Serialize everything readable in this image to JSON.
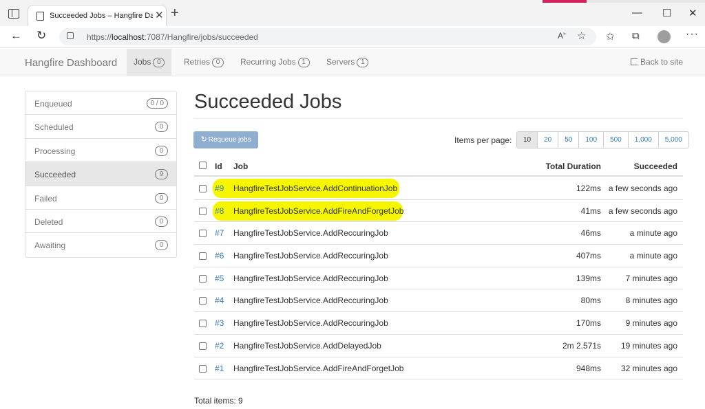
{
  "browser": {
    "tab_title": "Succeeded Jobs – Hangfire Dash",
    "url_prefix": "https://",
    "url_host": "localhost",
    "url_rest": ":7087/Hangfire/jobs/succeeded"
  },
  "navbar": {
    "brand": "Hangfire Dashboard",
    "items": [
      {
        "label": "Jobs",
        "count": "0"
      },
      {
        "label": "Retries",
        "count": "0"
      },
      {
        "label": "Recurring Jobs",
        "count": "1"
      },
      {
        "label": "Servers",
        "count": "1"
      }
    ],
    "back_label": "Back to site"
  },
  "sidebar": {
    "items": [
      {
        "label": "Enqueued",
        "count": "0 / 0"
      },
      {
        "label": "Scheduled",
        "count": "0"
      },
      {
        "label": "Processing",
        "count": "0"
      },
      {
        "label": "Succeeded",
        "count": "9"
      },
      {
        "label": "Failed",
        "count": "0"
      },
      {
        "label": "Deleted",
        "count": "0"
      },
      {
        "label": "Awaiting",
        "count": "0"
      }
    ]
  },
  "main": {
    "title": "Succeeded Jobs",
    "requeue_label": "Requeue jobs",
    "items_per_page_label": "Items per page:",
    "page_sizes": [
      "10",
      "20",
      "50",
      "100",
      "500",
      "1,000",
      "5,000"
    ],
    "table": {
      "headers": {
        "id": "Id",
        "job": "Job",
        "duration": "Total Duration",
        "succeeded": "Succeeded"
      },
      "rows": [
        {
          "id": "#9",
          "job": "HangfireTestJobService.AddContinuationJob",
          "duration": "122ms",
          "succeeded": "a few seconds ago"
        },
        {
          "id": "#8",
          "job": "HangfireTestJobService.AddFireAndForgetJob",
          "duration": "41ms",
          "succeeded": "a few seconds ago"
        },
        {
          "id": "#7",
          "job": "HangfireTestJobService.AddReccuringJob",
          "duration": "46ms",
          "succeeded": "a minute ago"
        },
        {
          "id": "#6",
          "job": "HangfireTestJobService.AddReccuringJob",
          "duration": "407ms",
          "succeeded": "a minute ago"
        },
        {
          "id": "#5",
          "job": "HangfireTestJobService.AddReccuringJob",
          "duration": "139ms",
          "succeeded": "7 minutes ago"
        },
        {
          "id": "#4",
          "job": "HangfireTestJobService.AddReccuringJob",
          "duration": "80ms",
          "succeeded": "8 minutes ago"
        },
        {
          "id": "#3",
          "job": "HangfireTestJobService.AddReccuringJob",
          "duration": "170ms",
          "succeeded": "9 minutes ago"
        },
        {
          "id": "#2",
          "job": "HangfireTestJobService.AddDelayedJob",
          "duration": "2m 2.571s",
          "succeeded": "19 minutes ago"
        },
        {
          "id": "#1",
          "job": "HangfireTestJobService.AddFireAndForgetJob",
          "duration": "948ms",
          "succeeded": "32 minutes ago"
        }
      ]
    },
    "total_label": "Total items: 9"
  },
  "colors": {
    "link": "#337ab7",
    "requeue_button": "#8faed0",
    "highlight": "#f6f600",
    "tab_accent": "#d5215b"
  }
}
